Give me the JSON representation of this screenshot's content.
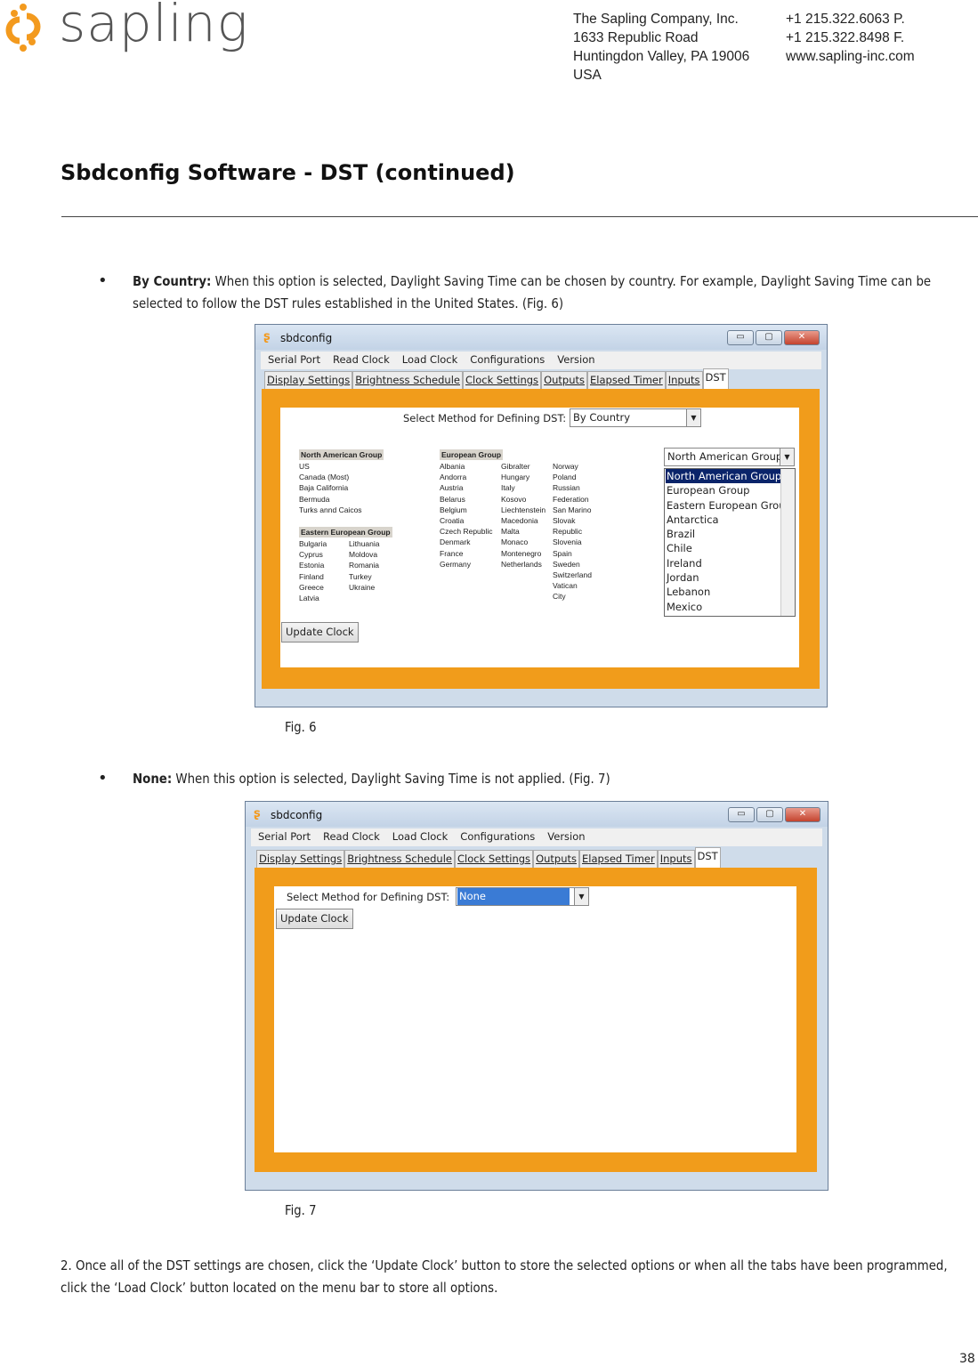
{
  "header": {
    "logo": "sapling",
    "company": "The Sapling Company, Inc.",
    "street": "1633 Republic Road",
    "city": "Huntingdon Valley, PA 19006",
    "country": "USA",
    "phone": "+1 215.322.6063 P.",
    "fax": "+1 215.322.8498 F.",
    "web": "www.sapling-inc.com"
  },
  "title": "Sbdconfig Software - DST (continued)",
  "bullet1": {
    "term": "By Country:",
    "text": " When this option is selected, Daylight Saving Time can be chosen by country. For example, Daylight Saving Time can be selected to follow the DST rules established in the United States. (Fig. 6)"
  },
  "bullet2": {
    "term": "None:",
    "text": " When this option is selected, Daylight Saving Time is not applied. (Fig. 7)"
  },
  "app": {
    "title": "sbdconfig",
    "menu": [
      "Serial Port",
      "Read Clock",
      "Load Clock",
      "Configurations",
      "Version"
    ],
    "tabs": [
      "Display Settings",
      "Brightness Schedule",
      "Clock Settings",
      "Outputs",
      "Elapsed Timer",
      "Inputs",
      "DST"
    ],
    "select_label": "Select Method for Defining DST:",
    "update": "Update Clock",
    "window_buttons": [
      "minimize",
      "maximize",
      "close"
    ]
  },
  "fig6": {
    "caption": "Fig. 6",
    "method": "By Country",
    "group_select": "North American Group",
    "north_american": {
      "title": "North American Group",
      "items": [
        "US",
        "Canada (Most)",
        "Baja California",
        "Bermuda",
        "Turks annd Caicos"
      ]
    },
    "eastern": {
      "title": "Eastern European Group",
      "col1": [
        "Bulgaria",
        "Cyprus",
        "Estonia",
        "Finland",
        "Greece",
        "Latvia"
      ],
      "col2": [
        "Lithuania",
        "Moldova",
        "Romania",
        "Turkey",
        "Ukraine"
      ]
    },
    "european": {
      "title": "European Group",
      "col1": [
        "Albania",
        "Andorra",
        "Austria",
        "Belarus",
        "Belgium",
        "Croatia",
        "Czech Republic",
        "Denmark",
        "France",
        "Germany"
      ],
      "col2": [
        "Gibralter",
        "Hungary",
        "Italy",
        "Kosovo",
        "Liechtenstein",
        "Macedonia",
        "Malta",
        "Monaco",
        "Montenegro",
        "Netherlands"
      ],
      "col3": [
        "Norway",
        "Poland",
        "Russian Federation",
        "San Marino",
        "Slovak Republic",
        "Slovenia",
        "Spain",
        "Sweden",
        "Switzerland",
        "Vatican City"
      ]
    },
    "list": [
      "North American Group",
      "European Group",
      "Eastern European Group",
      "Antarctica",
      "Brazil",
      "Chile",
      "Ireland",
      "Jordan",
      "Lebanon",
      "Mexico"
    ],
    "list_selected": "North American Group"
  },
  "fig7": {
    "caption": "Fig. 7",
    "method": "None"
  },
  "step2": "2. Once all of the DST settings are chosen, click the ‘Update Clock’ button to store the selected options or when all the tabs have been programmed, click the ‘Load Clock’ button located on the menu bar to store all options.",
  "page_number": "38",
  "colors": {
    "accent": "#f19c1b",
    "selection": "#0a246a"
  }
}
